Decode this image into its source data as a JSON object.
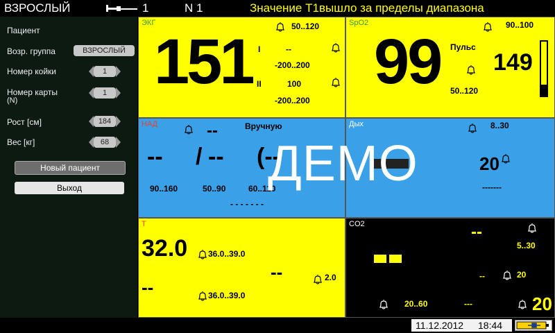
{
  "topbar": {
    "mode": "ВЗРОСЛЫЙ",
    "lead_number": "1",
    "network": "N 1",
    "alarm_message": "Значение T1вышло за пределы диапазона"
  },
  "sidebar": {
    "patient_label": "Пациент",
    "age_group_label": "Возр. группа",
    "age_group_value": "ВЗРОСЛЫЙ",
    "bed_label": "Номер койки",
    "bed_value": "1",
    "card_label": "Номер карты",
    "card_sub": "(N)",
    "card_value": "1",
    "height_label": "Рост [см]",
    "height_value": "184",
    "weight_label": "Вес [кг]",
    "weight_value": "68",
    "new_patient_button": "Новый пациент",
    "exit_button": "Выход"
  },
  "ecg": {
    "title": "ЭКГ",
    "hr_value": "151",
    "hr_limits": "50..120",
    "lead1_label": "I",
    "lead1_value": "--",
    "lead1_limits": "-200..200",
    "lead2_label": "II",
    "lead2_value": "100",
    "lead2_limits": "-200..200"
  },
  "spo2": {
    "title": "SpO2",
    "value": "99",
    "limits": "90..100",
    "pulse_label": "Пульс",
    "pulse_value": "149",
    "pulse_limits": "50..120",
    "perfusion_level": 0.2
  },
  "nibp": {
    "title": "НАД",
    "mode": "Вручную",
    "top_value": "--",
    "systolic": "--",
    "separator": "/",
    "diastolic": "--",
    "mean": "(--",
    "sys_limits": "90..160",
    "dia_limits": "50..90",
    "mean_limits": "60..110",
    "time": "- - - - - - -"
  },
  "resp": {
    "title": "Дых",
    "limits": "8..30",
    "value": "20",
    "extra": "-------"
  },
  "temp": {
    "title": "T",
    "t1_value": "32.0",
    "t1_limits": "36.0..39.0",
    "t2_value": "--",
    "t2_limits": "36.0..39.0",
    "delta_value": "--",
    "delta_limit": "2.0"
  },
  "co2": {
    "title": "CO2",
    "etco2_value": "--",
    "etco2_limits": "5..30",
    "fico2_value": "--",
    "fico2_limit": "20",
    "rr_limits": "20..60",
    "rr_value": "---",
    "awrr_value": "20"
  },
  "watermark": "ДЕМО",
  "status": {
    "date": "11.12.2012",
    "time": "18:44"
  },
  "colors": {
    "yellow": "#ffff00",
    "blue": "#3aa0e8",
    "alarm_text": "#ffff00",
    "sidebar_bg": "#0c1a12"
  }
}
